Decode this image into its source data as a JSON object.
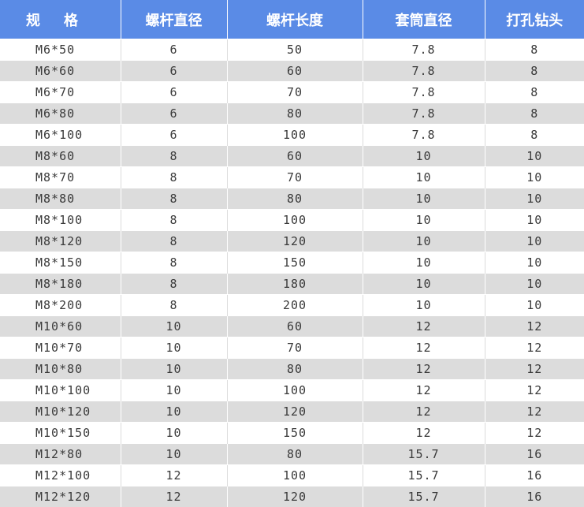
{
  "table": {
    "headers": [
      "规格",
      "螺杆直径",
      "螺杆长度",
      "套筒直径",
      "打孔钻头"
    ],
    "rows": [
      [
        "M6*50",
        "6",
        "50",
        "7.8",
        "8"
      ],
      [
        "M6*60",
        "6",
        "60",
        "7.8",
        "8"
      ],
      [
        "M6*70",
        "6",
        "70",
        "7.8",
        "8"
      ],
      [
        "M6*80",
        "6",
        "80",
        "7.8",
        "8"
      ],
      [
        "M6*100",
        "6",
        "100",
        "7.8",
        "8"
      ],
      [
        "M8*60",
        "8",
        "60",
        "10",
        "10"
      ],
      [
        "M8*70",
        "8",
        "70",
        "10",
        "10"
      ],
      [
        "M8*80",
        "8",
        "80",
        "10",
        "10"
      ],
      [
        "M8*100",
        "8",
        "100",
        "10",
        "10"
      ],
      [
        "M8*120",
        "8",
        "120",
        "10",
        "10"
      ],
      [
        "M8*150",
        "8",
        "150",
        "10",
        "10"
      ],
      [
        "M8*180",
        "8",
        "180",
        "10",
        "10"
      ],
      [
        "M8*200",
        "8",
        "200",
        "10",
        "10"
      ],
      [
        "M10*60",
        "10",
        "60",
        "12",
        "12"
      ],
      [
        "M10*70",
        "10",
        "70",
        "12",
        "12"
      ],
      [
        "M10*80",
        "10",
        "80",
        "12",
        "12"
      ],
      [
        "M10*100",
        "10",
        "100",
        "12",
        "12"
      ],
      [
        "M10*120",
        "10",
        "120",
        "12",
        "12"
      ],
      [
        "M10*150",
        "10",
        "150",
        "12",
        "12"
      ],
      [
        "M12*80",
        "10",
        "80",
        "15.7",
        "16"
      ],
      [
        "M12*100",
        "12",
        "100",
        "15.7",
        "16"
      ],
      [
        "M12*120",
        "12",
        "120",
        "15.7",
        "16"
      ]
    ]
  },
  "colors": {
    "header_bg": "#5a8be6",
    "header_text": "#ffffff",
    "stripe": "#dcdcdc",
    "cell_text": "#3a3a3a"
  }
}
